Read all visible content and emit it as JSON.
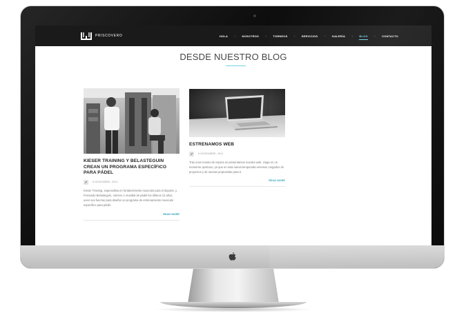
{
  "site": {
    "brand": "PRISCOVERO",
    "nav": {
      "items": [
        {
          "label": "HOLA"
        },
        {
          "label": "NOSOTROS"
        },
        {
          "label": "TORNEOS"
        },
        {
          "label": "SERVICIOS"
        },
        {
          "label": "GALERÍA"
        },
        {
          "label": "BLOG",
          "active": true
        },
        {
          "label": "CONTACTO"
        }
      ],
      "separator": "+"
    },
    "page_title": "DESDE NUESTRO BLOG",
    "posts": [
      {
        "title": "KIESER TRAINING Y BELASTEGUIN CREAN UN PROGRAMA ESPECÍFICO PARA PÁDEL",
        "date": "8 NOVIEMBRE, 2014",
        "excerpt": "Kieser Training, especialista en fortalecimiento muscular para el deporte, y Fernando Belasteguín, número 1 mundial de pádel los últimos 13 años, unen sus fuerzas para diseñar un programa de entrenamiento muscular específico para pádel.",
        "read_more": "READ MORE"
      },
      {
        "title": "ESTRENAMOS WEB",
        "date": "8 NOVIEMBRE, 2014",
        "excerpt": "Tras unos meses de espera os presentamos nuestra web. Llega en un momento oportuno, ya que en esta nueva temporada veremos cargados de proyectos y de nuevas propuestas para ti.",
        "read_more": "READ MORE"
      }
    ]
  },
  "colors": {
    "accent": "#6fd4e4",
    "link": "#2fa3b8",
    "nav_bg": "#1a1a1a",
    "bezel": "#0c0c0c"
  },
  "icons": [
    "brand-logo-icon",
    "pencil-icon",
    "apple-logo-icon"
  ]
}
